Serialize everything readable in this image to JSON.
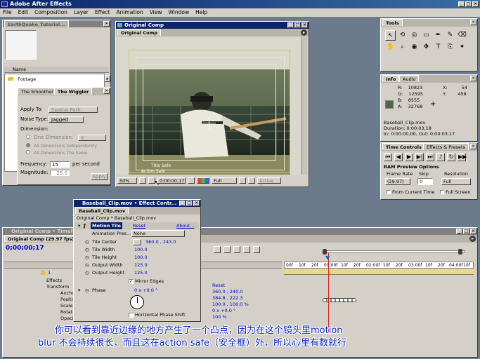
{
  "app": {
    "title": "Adobe After Effects"
  },
  "menu": [
    "File",
    "Edit",
    "Composition",
    "Layer",
    "Effect",
    "Animation",
    "View",
    "Window",
    "Help"
  ],
  "project": {
    "tab": "EarthQuake_Tutorial...",
    "column": "Name",
    "folder": "Footage"
  },
  "effect_panel": {
    "tabs": [
      "The Smoother",
      "The Wiggler"
    ],
    "apply_to_label": "Apply To:",
    "apply_to": "Spatial Path",
    "noise_label": "Noise Type:",
    "noise": "Jagged",
    "dimension_label": "Dimension:",
    "dim_one": "One Dimension:",
    "dim_one_val": "X",
    "dim_all_indep": "All Dimensions Independently",
    "dim_all_same": "All Dimensions The Same",
    "freq_label": "Frequency:",
    "freq": "15",
    "freq_unit": "per second",
    "mag_label": "Magnitude:",
    "mag": "25.0",
    "apply": "Apply"
  },
  "comp_viewer": {
    "title": "Original Comp",
    "tab": "Original Comp",
    "title_safe": "Title Safe",
    "action_safe": "Action Safe",
    "zoom": "50%",
    "timecode": "0:00:00,17",
    "resolution": "Full",
    "view": "Active C..."
  },
  "tools": {
    "tab": "Tools"
  },
  "info": {
    "tabs": [
      "Info",
      "Audio"
    ],
    "r_label": "R:",
    "r": "10823",
    "g_label": "G:",
    "g": "12595",
    "b_label": "B:",
    "b": "8555",
    "a_label": "A:",
    "a": "32768",
    "x_label": "X:",
    "x": "54",
    "y_label": "Y:",
    "y": "458",
    "clip": "Baseball_Clip.mov",
    "duration": "Duration: 0:00:03,18",
    "inout": "In: 0:00:00,00, Out: 0:00:03,17"
  },
  "time_controls": {
    "tabs": [
      "Time Controls",
      "Effects & Presets"
    ],
    "ram_title": "RAM Preview Options",
    "rate_label": "Frame Rate",
    "skip_label": "Skip",
    "res_label": "Resolution",
    "rate": "(29.97)",
    "skip": "0",
    "res": "Full",
    "from_current": "From Current Time",
    "full_screen": "Full Screen"
  },
  "effect_controls": {
    "title": "Baseball_Clip.mov • Effect Contr...",
    "tab": "Baseball_Clip.mov",
    "breadcrumb": "Original Comp * Baseball_Clip.mov",
    "effect_name": "Motion Tile",
    "reset": "Reset",
    "about": "About...",
    "presets_label": "Animation Pres...",
    "presets_val": "None",
    "props": [
      {
        "name": "Tile Center",
        "value": "360.0 , 243.0"
      },
      {
        "name": "Tile Width",
        "value": "100.0"
      },
      {
        "name": "Tile Height",
        "value": "100.0"
      },
      {
        "name": "Output Width",
        "value": "125.0"
      },
      {
        "name": "Output Height",
        "value": "125.0"
      }
    ],
    "mirror_edges": "Mirror Edges",
    "phase_label": "Phase",
    "phase_val": "0 x +0.0 °",
    "hphase": "Horizontal Phase Shift"
  },
  "timeline": {
    "title": "Original Comp • Timeline",
    "tab": "Original Comp (29.97 fps)",
    "timecode": "0;00;00;17",
    "layer_num": "1",
    "layers": [
      "Effects",
      "Transform",
      "Anchor",
      "Position",
      "Scale",
      "Rotation",
      "Opacity"
    ],
    "ruler": [
      "00f",
      "10f",
      "20f",
      "01:00f",
      "10f",
      "20f",
      "02:00f",
      "10f",
      "20f",
      "03:00f",
      "10f",
      "20f",
      "04:00f",
      "10f"
    ],
    "values": [
      "Reset",
      "360.0 , 240.0",
      "384.8 , 222.3",
      "100.0 , 100.0 %",
      "0 x +0.0 °",
      "100 %"
    ]
  },
  "subtitle": {
    "line1": "你可以看到靠近边缘的地方产生了一个凸点，因为在这个镜头里motion",
    "line2": "blur 不会持续很长，而且这在action safe（安全框）外，所以心里有数就行"
  }
}
